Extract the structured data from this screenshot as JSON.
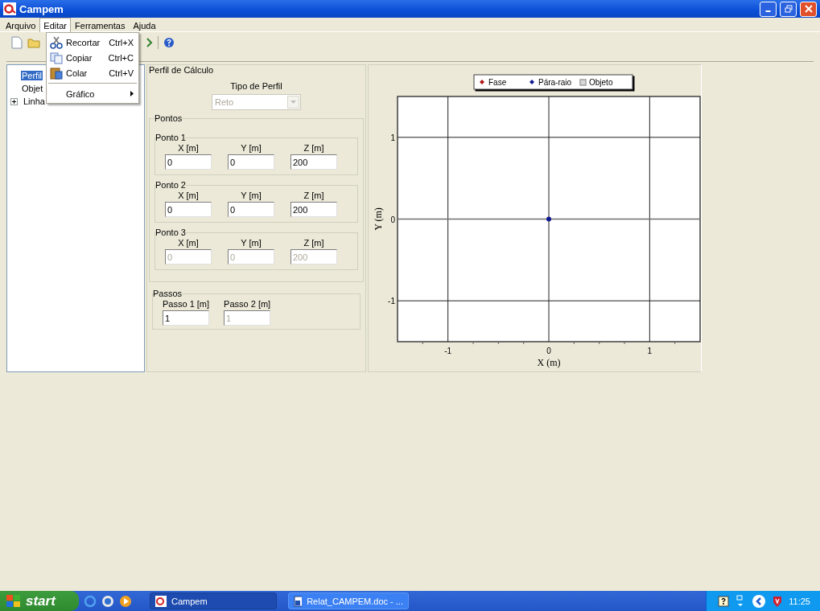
{
  "window": {
    "title": "Campem"
  },
  "menu_bar": [
    {
      "label": "Arquivo",
      "selected": false
    },
    {
      "label": "Editar",
      "selected": true
    },
    {
      "label": "Ferramentas",
      "selected": false
    },
    {
      "label": "Ajuda",
      "selected": false
    }
  ],
  "open_menu": {
    "items": [
      {
        "kind": "command",
        "label": "Recortar",
        "shortcut": "Ctrl+X"
      },
      {
        "kind": "command",
        "label": "Copiar",
        "shortcut": "Ctrl+C"
      },
      {
        "kind": "command",
        "label": "Colar",
        "shortcut": "Ctrl+V"
      },
      {
        "kind": "separator"
      },
      {
        "kind": "submenu",
        "label": "Gráfico"
      }
    ]
  },
  "tree": [
    {
      "label": "Perfil",
      "selected": true
    },
    {
      "label": "Objet",
      "selected": false
    },
    {
      "label": "Linha",
      "selected": false,
      "expanded": false
    }
  ],
  "form": {
    "title": "Perfil de Cálculo",
    "profile_type": {
      "label": "Tipo de Perfil",
      "value": "Reto",
      "disabled": true
    },
    "points_group": "Pontos",
    "points": [
      {
        "title": "Ponto 1",
        "fields": [
          {
            "label": "X [m]",
            "value": "0",
            "disabled": false
          },
          {
            "label": "Y [m]",
            "value": "0",
            "disabled": false
          },
          {
            "label": "Z [m]",
            "value": "200",
            "disabled": false
          }
        ]
      },
      {
        "title": "Ponto 2",
        "fields": [
          {
            "label": "X [m]",
            "value": "0",
            "disabled": false
          },
          {
            "label": "Y [m]",
            "value": "0",
            "disabled": false
          },
          {
            "label": "Z [m]",
            "value": "200",
            "disabled": false
          }
        ]
      },
      {
        "title": "Ponto 3",
        "fields": [
          {
            "label": "X [m]",
            "value": "0",
            "disabled": true
          },
          {
            "label": "Y [m]",
            "value": "0",
            "disabled": true
          },
          {
            "label": "Z [m]",
            "value": "200",
            "disabled": true
          }
        ]
      }
    ],
    "steps": {
      "title": "Passos",
      "fields": [
        {
          "label": "Passo 1 [m]",
          "value": "1",
          "disabled": false
        },
        {
          "label": "Passo 2 [m]",
          "value": "1",
          "disabled": true
        }
      ]
    }
  },
  "chart": {
    "chart_data": {
      "type": "scatter",
      "xlabel": "X (m)",
      "ylabel": "Y (m)",
      "x": [
        0
      ],
      "xlim": [
        -1.5,
        1.5
      ],
      "ylim": [
        -1.5,
        1.5
      ],
      "xticks": [
        -1,
        0,
        1
      ],
      "yticks": [
        1,
        0,
        -1
      ],
      "grid": true,
      "series": [
        {
          "name": "Fase",
          "color": "#b01818",
          "values": [
            null
          ]
        },
        {
          "name": "Pára-raio",
          "color": "#101890",
          "values": [
            0
          ]
        },
        {
          "name": "Objeto",
          "color": "#a0a0a0",
          "values": [
            null
          ]
        }
      ]
    }
  },
  "taskbar": {
    "start": "start",
    "tasks": [
      {
        "label": "Campem",
        "selected": true
      },
      {
        "label": "Relat_CAMPEM.doc - ...",
        "selected": false
      }
    ],
    "clock": "11:25"
  }
}
